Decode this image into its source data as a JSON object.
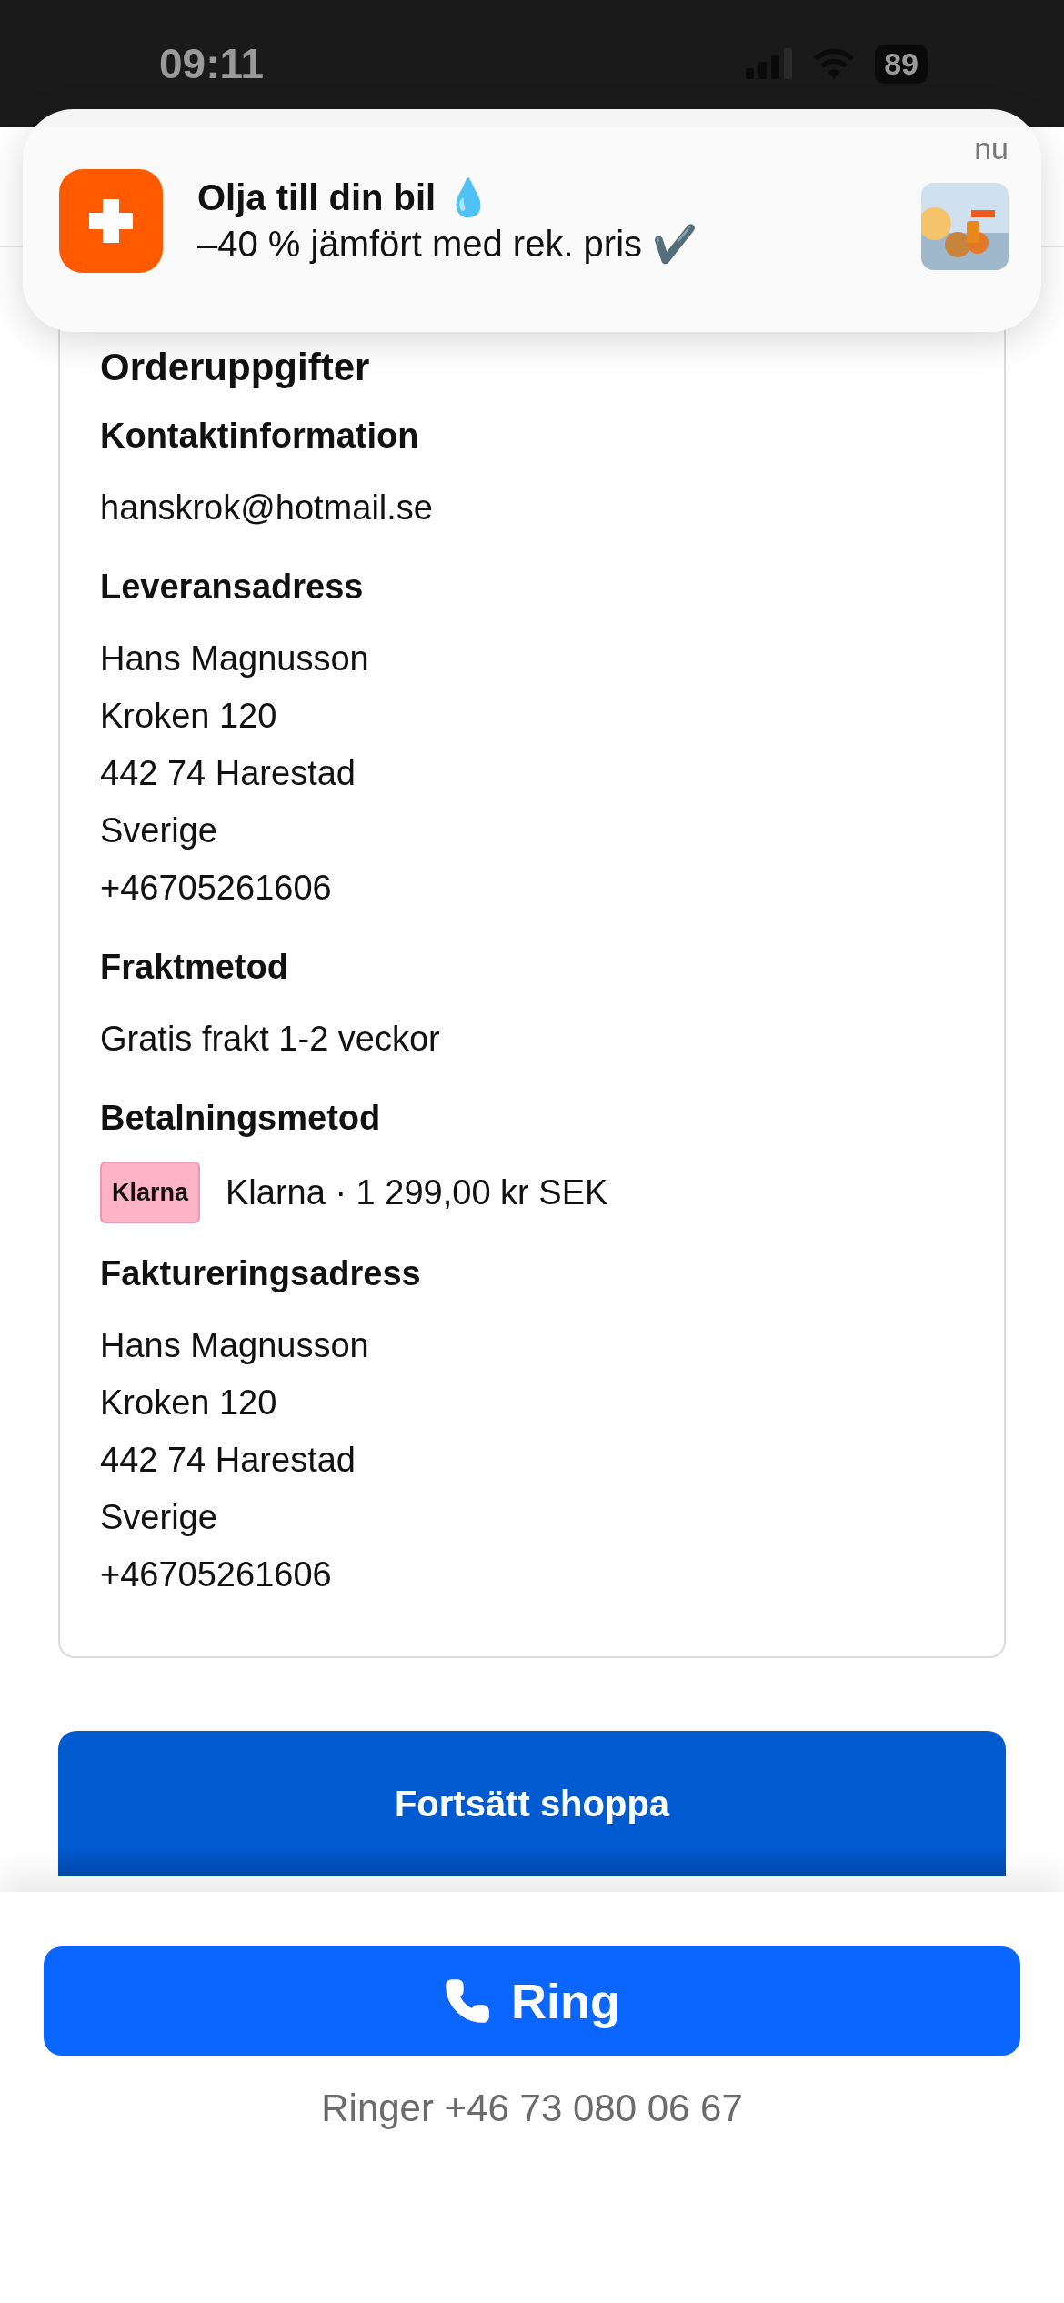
{
  "status_bar": {
    "time": "09:11",
    "battery": "89"
  },
  "notification": {
    "title": "Olja till din bil 💧",
    "body": "–40 % jämfört med rek. pris ✔️",
    "time": "nu"
  },
  "order": {
    "heading": "Orderuppgifter",
    "sections": [
      {
        "kind": "text",
        "title": "Kontaktinformation",
        "lines": [
          "hanskrok@hotmail.se"
        ]
      },
      {
        "kind": "text",
        "title": "Leveransadress",
        "lines": [
          "Hans Magnusson",
          "Kroken 120",
          "442 74 Harestad",
          "Sverige",
          "+46705261606"
        ]
      },
      {
        "kind": "text",
        "title": "Fraktmetod",
        "lines": [
          "Gratis frakt 1-2 veckor"
        ]
      },
      {
        "kind": "payment",
        "title": "Betalningsmetod",
        "badge": "Klarna",
        "lines": [
          "Klarna · 1 299,00 kr SEK"
        ]
      },
      {
        "kind": "text",
        "title": "Faktureringsadress",
        "lines": [
          "Hans Magnusson",
          "Kroken 120",
          "442 74 Harestad",
          "Sverige",
          "+46705261606"
        ]
      }
    ]
  },
  "continue_button": "Fortsätt shoppa",
  "call_sheet": {
    "button": "Ring",
    "caption": "Ringer +46 73 080 06 67"
  }
}
